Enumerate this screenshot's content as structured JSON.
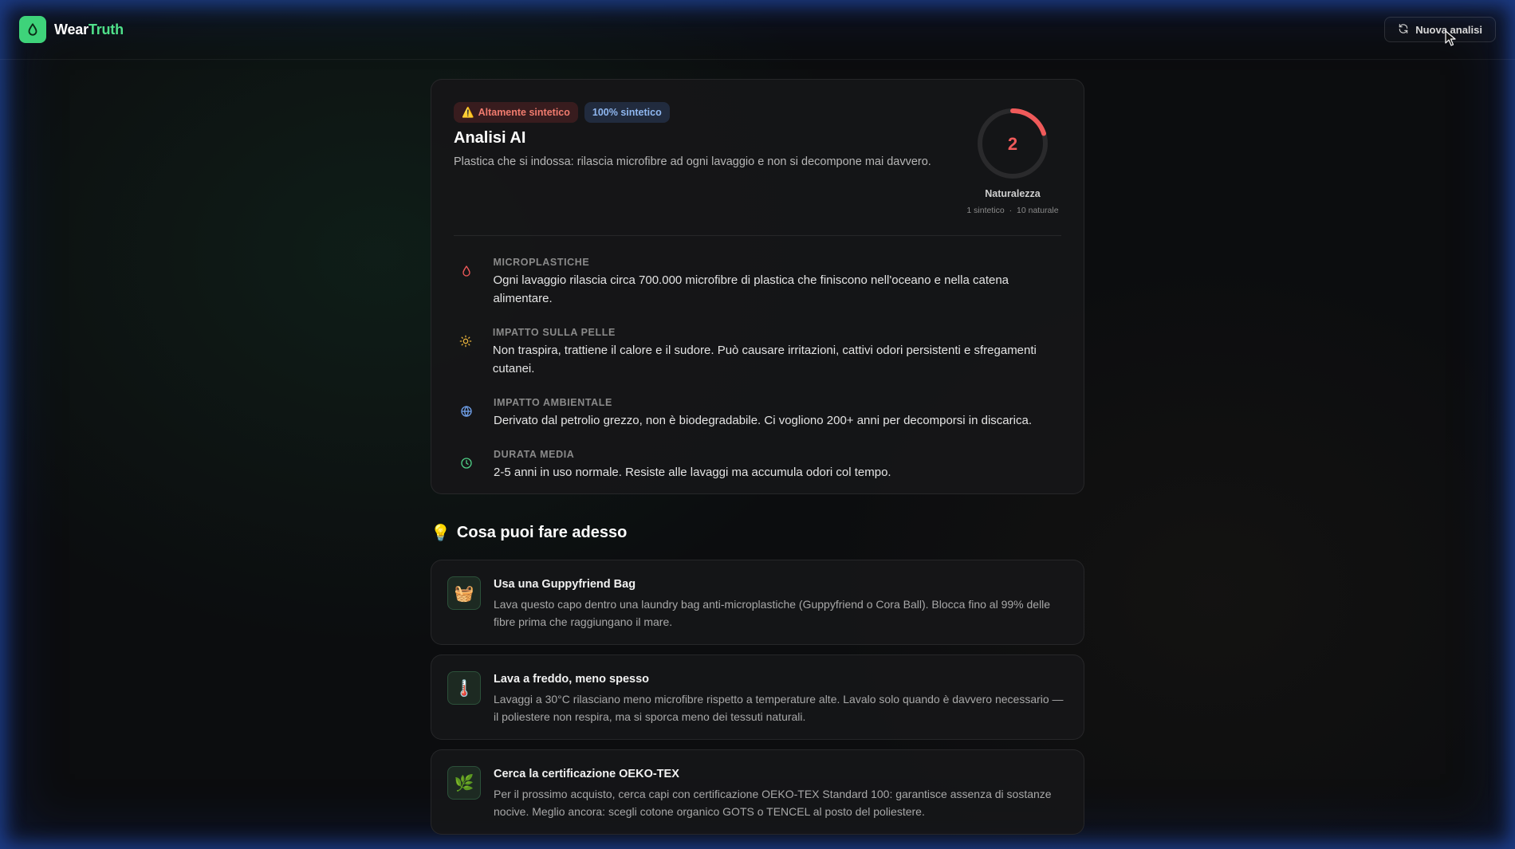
{
  "header": {
    "brand_prefix": "Wear",
    "brand_suffix": "Truth",
    "new_analysis_label": "Nuova analisi"
  },
  "analysis": {
    "badge_warning": "Altamente sintetico",
    "badge_synthetic": "100% sintetico",
    "title": "Analisi AI",
    "description": "Plastica che si indossa: rilascia microfibre ad ogni lavaggio e non si decompone mai davvero.",
    "score": {
      "value": "2",
      "max": 10,
      "label": "Naturalezza",
      "scale_min": "1 sintetico",
      "scale_max": "10 naturale",
      "color": "#ef5a5a"
    },
    "facts": [
      {
        "icon": "droplet-icon",
        "label": "MICROPLASTICHE",
        "text": "Ogni lavaggio rilascia circa 700.000 microfibre di plastica che finiscono nell'oceano e nella catena alimentare."
      },
      {
        "icon": "sun-icon",
        "label": "IMPATTO SULLA PELLE",
        "text": "Non traspira, trattiene il calore e il sudore. Può causare irritazioni, cattivi odori persistenti e sfregamenti cutanei."
      },
      {
        "icon": "globe-icon",
        "label": "IMPATTO AMBIENTALE",
        "text": "Derivato dal petrolio grezzo, non è biodegradabile. Ci vogliono 200+ anni per decomporsi in discarica."
      },
      {
        "icon": "clock-icon",
        "label": "DURATA MEDIA",
        "text": "2-5 anni in uso normale. Resiste alle lavaggi ma accumula odori col tempo."
      }
    ]
  },
  "tips_section": {
    "emoji": "💡",
    "title": "Cosa puoi fare adesso",
    "tips": [
      {
        "emoji": "🧺",
        "title": "Usa una Guppyfriend Bag",
        "text": "Lava questo capo dentro una laundry bag anti-microplastiche (Guppyfriend o Cora Ball). Blocca fino al 99% delle fibre prima che raggiungano il mare."
      },
      {
        "emoji": "🌡️",
        "title": "Lava a freddo, meno spesso",
        "text": "Lavaggi a 30°C rilasciano meno microfibre rispetto a temperature alte. Lavalo solo quando è davvero necessario — il poliestere non respira, ma si sporca meno dei tessuti naturali."
      },
      {
        "emoji": "🌿",
        "title": "Cerca la certificazione OEKO-TEX",
        "text": "Per il prossimo acquisto, cerca capi con certificazione OEKO-TEX Standard 100: garantisce assenza di sostanze nocive. Meglio ancora: scegli cotone organico GOTS o TENCEL al posto del poliestere."
      }
    ]
  }
}
